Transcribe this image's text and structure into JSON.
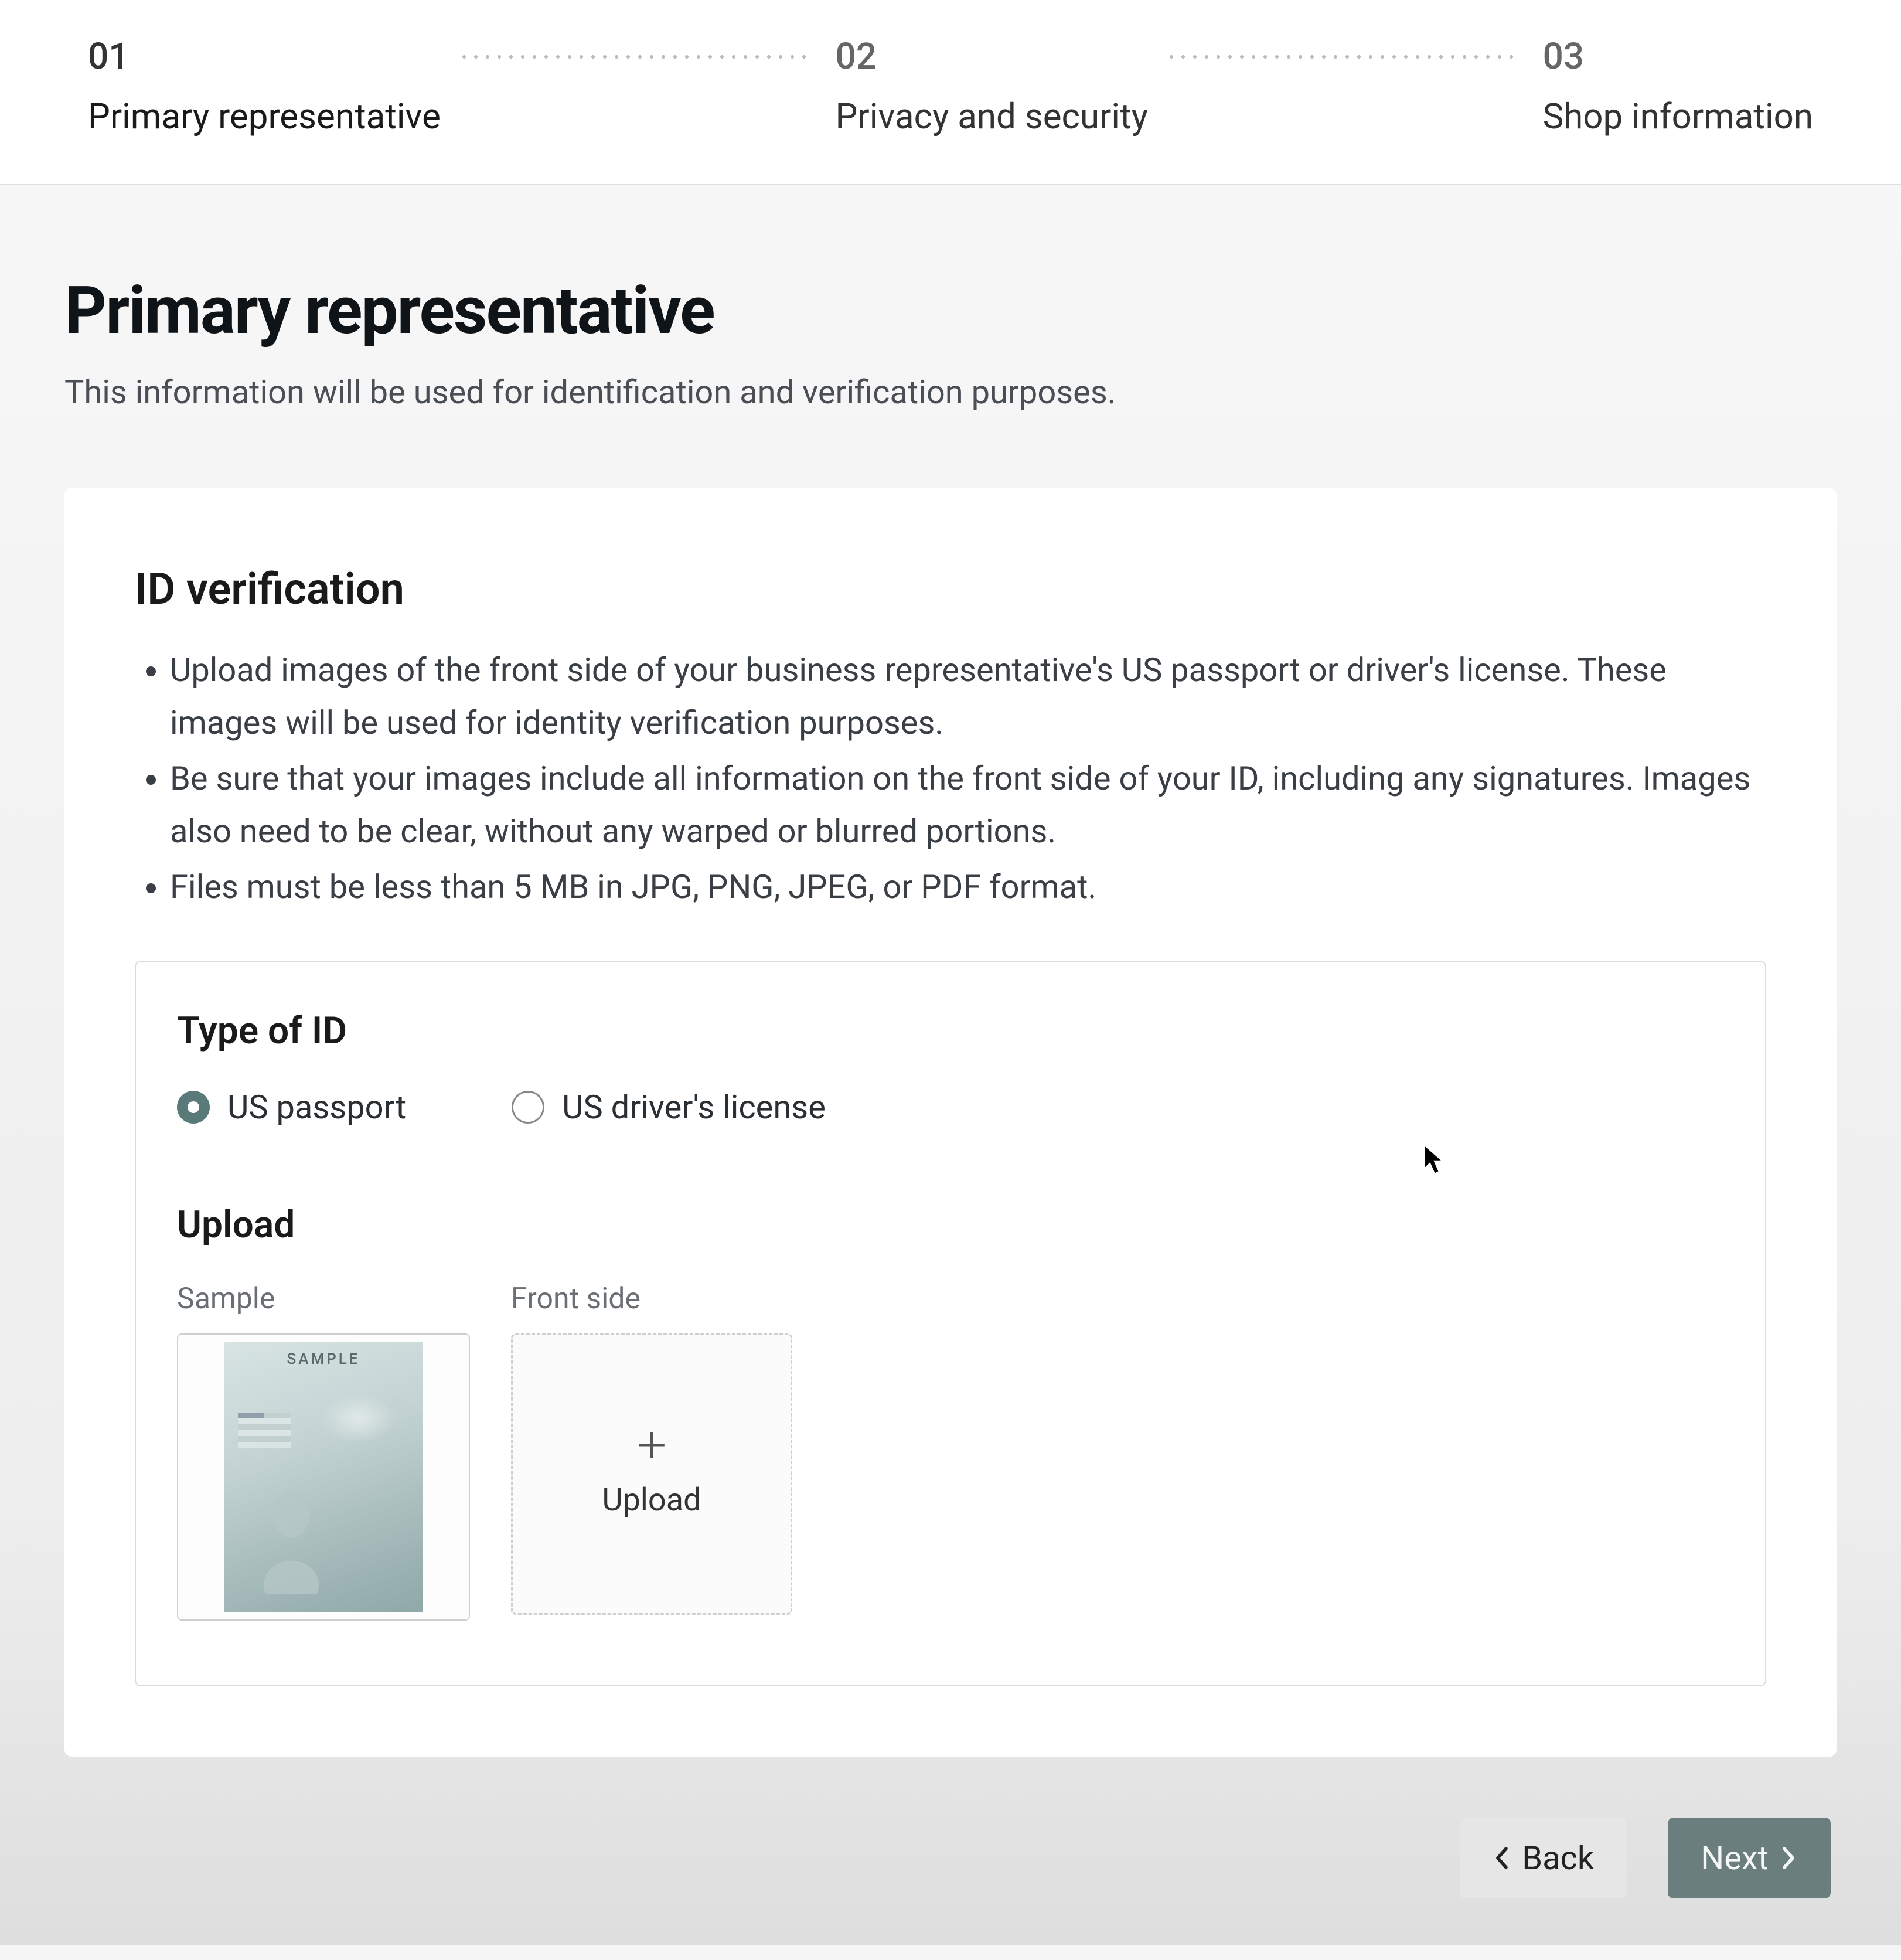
{
  "stepper": {
    "steps": [
      {
        "num": "01",
        "label": "Primary representative"
      },
      {
        "num": "02",
        "label": "Privacy and security"
      },
      {
        "num": "03",
        "label": "Shop information"
      }
    ]
  },
  "header": {
    "title": "Primary representative",
    "subtitle": "This information will be used for identification and verification purposes."
  },
  "id_verification": {
    "title": "ID verification",
    "bullets": [
      "Upload images of the front side of your business representative's US passport or driver's license. These images will be used for identity verification purposes.",
      "Be sure that your images include all information on the front side of your ID, including any signatures. Images also need to be clear, without any warped or blurred portions.",
      "Files must be less than 5 MB in JPG, PNG, JPEG, or PDF format."
    ],
    "type_label": "Type of ID",
    "radios": [
      {
        "label": "US passport",
        "selected": true
      },
      {
        "label": "US driver's license",
        "selected": false
      }
    ],
    "upload_label": "Upload",
    "sample_label": "Sample",
    "sample_tag": "SAMPLE",
    "front_label": "Front side",
    "upload_button": "Upload"
  },
  "footer": {
    "back": "Back",
    "next": "Next"
  }
}
